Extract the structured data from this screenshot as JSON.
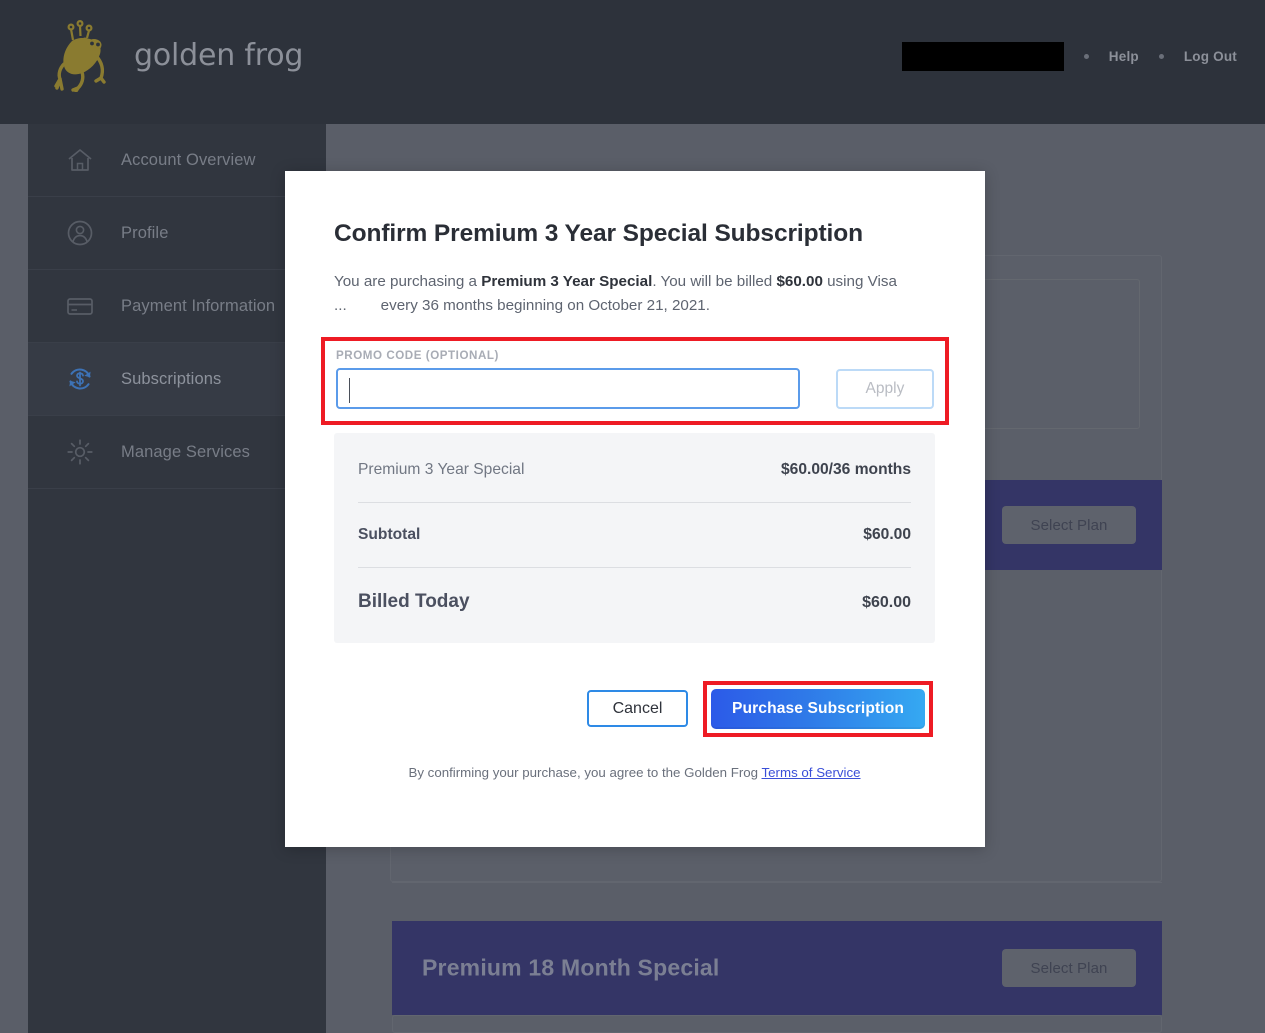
{
  "header": {
    "brand": "golden frog",
    "logo_icon": "golden-frog-logo-icon",
    "account_redacted": "",
    "help_label": "Help",
    "logout_label": "Log Out",
    "background_color": "#2d323b",
    "brand_gold": "#8a7b30"
  },
  "sidebar": {
    "items": [
      {
        "label": "Account Overview",
        "icon": "home-icon",
        "active": false
      },
      {
        "label": "Profile",
        "icon": "user-circle-icon",
        "active": false
      },
      {
        "label": "Payment Information",
        "icon": "credit-card-icon",
        "active": false
      },
      {
        "label": "Subscriptions",
        "icon": "subscription-refresh-dollar-icon",
        "active": true
      },
      {
        "label": "Manage Services",
        "icon": "gear-icon",
        "active": false
      }
    ]
  },
  "background_page": {
    "plans": [
      {
        "title": "",
        "button_label": "Select Plan"
      },
      {
        "title": "Premium 18 Month Special",
        "button_label": "Select Plan"
      }
    ]
  },
  "modal": {
    "title": "Confirm Premium 3 Year Special Subscription",
    "description": {
      "part1": "You are purchasing a ",
      "plan_bold": "Premium 3 Year Special",
      "part2": ". You will be billed ",
      "price_bold": "$60.00",
      "part3": " using Visa",
      "ellipsis": "...",
      "part4": "every 36 months beginning on October 21, 2021."
    },
    "promo": {
      "label": "PROMO CODE  (OPTIONAL)",
      "input_value": "",
      "input_placeholder": "",
      "apply_label": "Apply",
      "highlight_color": "#ee1b24",
      "focus_color": "#5b9bea"
    },
    "summary": {
      "line_item_label": "Premium 3 Year Special",
      "line_item_value": "$60.00/36 months",
      "subtotal_label": "Subtotal",
      "subtotal_value": "$60.00",
      "billed_today_label": "Billed Today",
      "billed_today_value": "$60.00"
    },
    "actions": {
      "cancel_label": "Cancel",
      "purchase_label": "Purchase Subscription",
      "purchase_gradient_from": "#2c5ae8",
      "purchase_gradient_to": "#35a9f2"
    },
    "terms": {
      "text": "By confirming your purchase, you agree to the Golden Frog ",
      "link_label": "Terms of Service"
    }
  }
}
